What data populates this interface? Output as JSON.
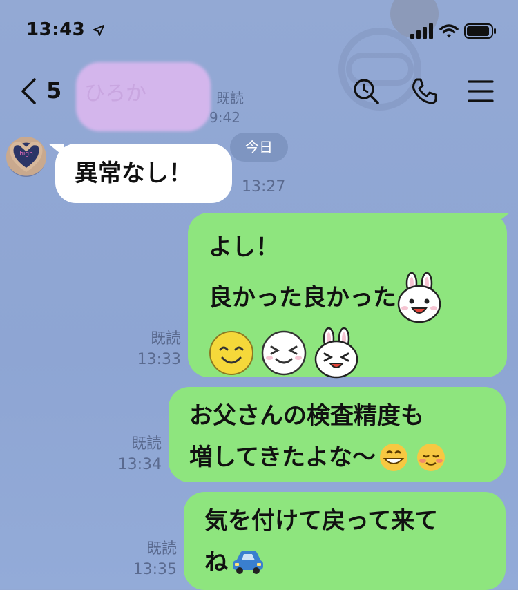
{
  "status": {
    "time": "13:43"
  },
  "header": {
    "unread_count": "5",
    "contact_name": "ひろか",
    "read_label": "既読",
    "read_time": "9:42"
  },
  "date_divider": "今日",
  "messages": [
    {
      "side": "left",
      "text": "異常なし！",
      "time": "13:27"
    },
    {
      "side": "right",
      "lines": [
        "よし！",
        "良かった良かった"
      ],
      "read": "既読",
      "time": "13:33"
    },
    {
      "side": "right",
      "lines": [
        "お父さんの検査精度も",
        "増してきたよな〜"
      ],
      "read": "既読",
      "time": "13:34"
    },
    {
      "side": "right",
      "lines": [
        "気を付けて戻って来て",
        "ね"
      ],
      "read": "既読",
      "time": "13:35"
    }
  ],
  "icons": [
    "location-arrow-icon",
    "signal-icon",
    "wifi-icon",
    "battery-icon",
    "back-chevron-icon",
    "search-icon",
    "phone-icon",
    "menu-icon",
    "bunny-icon",
    "smile-icon",
    "laugh-face-icon",
    "grin-icon",
    "blush-icon",
    "car-icon"
  ]
}
